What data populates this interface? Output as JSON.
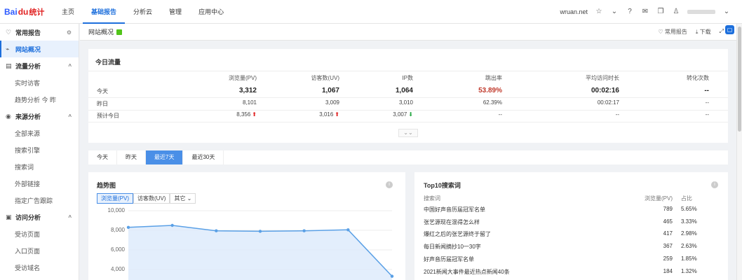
{
  "brand": {
    "logo_text": "Bai",
    "logo_paw": "du",
    "logo_zh": "统计"
  },
  "topnav": {
    "items": [
      "主页",
      "基础报告",
      "分析云",
      "管理",
      "应用中心"
    ],
    "active_index": 1
  },
  "topright": {
    "site": "wruan.net"
  },
  "sidebar": [
    {
      "label": "常用报告",
      "type": "head",
      "icon": "heart-icon",
      "tail": "⚙"
    },
    {
      "label": "网站概况",
      "type": "head",
      "icon": "chart-icon",
      "active": true
    },
    {
      "label": "流量分析",
      "type": "head",
      "icon": "flow-icon",
      "tail": "^"
    },
    {
      "label": "实时访客",
      "type": "sub"
    },
    {
      "label": "趋势分析 今 昨",
      "type": "sub"
    },
    {
      "label": "来源分析",
      "type": "head",
      "icon": "source-icon",
      "tail": "^"
    },
    {
      "label": "全部来源",
      "type": "sub"
    },
    {
      "label": "搜索引擎",
      "type": "sub"
    },
    {
      "label": "搜索词",
      "type": "sub"
    },
    {
      "label": "外部链接",
      "type": "sub"
    },
    {
      "label": "指定广告跟踪",
      "type": "sub"
    },
    {
      "label": "访问分析",
      "type": "head",
      "icon": "visit-icon",
      "tail": "^"
    },
    {
      "label": "受访页面",
      "type": "sub"
    },
    {
      "label": "入口页面",
      "type": "sub"
    },
    {
      "label": "受访域名",
      "type": "sub"
    }
  ],
  "subbar": {
    "title": "网站概况",
    "fav": "常用报告",
    "download": "下载"
  },
  "today": {
    "title": "今日流量",
    "headers": [
      "浏览量(PV)",
      "访客数(UV)",
      "IP数",
      "跳出率",
      "平均访问时长",
      "转化次数"
    ],
    "rows": [
      {
        "label": "今天",
        "values": [
          "3,312",
          "1,067",
          "1,064",
          "53.89%",
          "00:02:16",
          "--"
        ]
      },
      {
        "label": "昨日",
        "values": [
          "8,101",
          "3,009",
          "3,010",
          "62.39%",
          "00:02:17",
          "--"
        ]
      },
      {
        "label": "预计今日",
        "values": [
          "8,356",
          "3,016",
          "3,007",
          "--",
          "--",
          "--"
        ],
        "arrows": [
          "up",
          "up",
          "down",
          "",
          "",
          ""
        ]
      }
    ]
  },
  "range_tabs": {
    "items": [
      "今天",
      "昨天",
      "最近7天",
      "最近30天"
    ],
    "active_index": 2
  },
  "trend": {
    "title": "趋势图",
    "metrics": [
      "浏览量(PV)",
      "访客数(UV)",
      "其它 ⌄"
    ],
    "active_metric": 0,
    "yticks": [
      "10,000",
      "8,000",
      "6,000",
      "4,000"
    ]
  },
  "chart_data": {
    "type": "area",
    "title": "趋势图",
    "series": [
      {
        "name": "浏览量(PV)",
        "values": [
          8300,
          8500,
          7950,
          7900,
          7950,
          8050,
          3312
        ]
      }
    ],
    "ylim": [
      3500,
      10000
    ],
    "yticks": [
      4000,
      6000,
      8000,
      10000
    ],
    "grid": true,
    "color": "#5aa0e6"
  },
  "top10": {
    "title": "Top10搜索词",
    "headers": {
      "kw": "搜索词",
      "pv": "浏览量(PV)",
      "pct": "占比"
    },
    "rows": [
      {
        "kw": "中国好声音历届冠军名单",
        "pv": "789",
        "pct": "5.65%"
      },
      {
        "kw": "张艺源现在混得怎么样",
        "pv": "465",
        "pct": "3.33%"
      },
      {
        "kw": "爆红之后的张艺源终于留了",
        "pv": "417",
        "pct": "2.98%"
      },
      {
        "kw": "每日新闻摘抄10一30字",
        "pv": "367",
        "pct": "2.63%"
      },
      {
        "kw": "好声音历届冠军名单",
        "pv": "259",
        "pct": "1.85%"
      },
      {
        "kw": "2021新闻大事件最近热点新闻40条",
        "pv": "184",
        "pct": "1.32%"
      }
    ]
  },
  "colors": {
    "accent": "#1d6fdc",
    "up": "#e02020",
    "down": "#27a844"
  }
}
